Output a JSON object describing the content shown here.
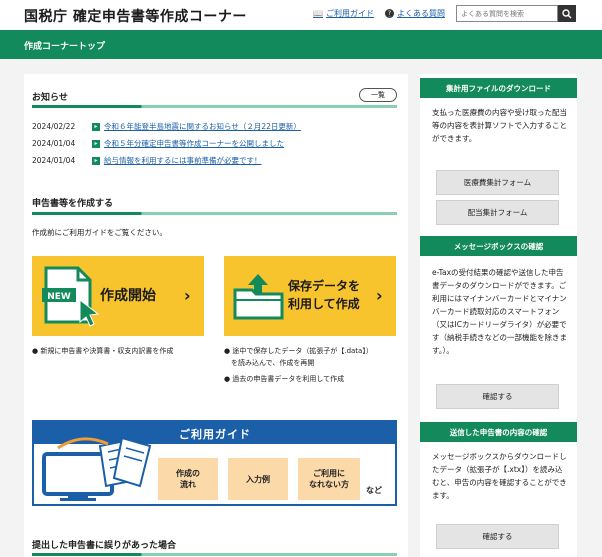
{
  "header": {
    "site_title": "国税庁 確定申告書等作成コーナー",
    "guide_link": "ご利用ガイド",
    "faq_link": "よくある質問",
    "search_placeholder": "よくある質問を検索"
  },
  "page_bar": {
    "title": "作成コーナートップ"
  },
  "news": {
    "title": "お知らせ",
    "list_button": "一覧",
    "items": [
      {
        "date": "2024/02/22",
        "text": "令和６年能登半島地震に関するお知らせ（２月22日更新）"
      },
      {
        "date": "2024/01/04",
        "text": "令和５年分確定申告書等作成コーナーを公開しました"
      },
      {
        "date": "2024/01/04",
        "text": "給与情報を利用するには事前準備が必要です！"
      }
    ]
  },
  "create": {
    "title": "申告書等を作成する",
    "note": "作成前にご利用ガイドをご覧ください。",
    "new_button": {
      "badge": "NEW",
      "label": "作成開始"
    },
    "saved_button": {
      "label_line1": "保存データを",
      "label_line2": "利用して作成"
    },
    "new_bullets": [
      "新規に申告書や決算書・収支内訳書を作成"
    ],
    "saved_bullets": [
      "途中で保存したデータ（拡張子が【.data】）",
      "を読み込んで、作成を再開",
      "過去の申告書データを利用して作成"
    ]
  },
  "guide_banner": {
    "title": "ご利用ガイド",
    "card1_line1": "作成の",
    "card1_line2": "流れ",
    "card2": "入力例",
    "card3_line1": "ご利用に",
    "card3_line2": "なれない方",
    "suffix": "など"
  },
  "submitted": {
    "title": "提出した申告書に誤りがあった場合"
  },
  "sidebar": {
    "download": {
      "title": "集計用ファイルのダウンロード",
      "text": "支払った医療費の内容や受け取った配当等の内容を表計算ソフトで入力することができます。",
      "btn1": "医療費集計フォーム",
      "btn2": "配当集計フォーム"
    },
    "messagebox": {
      "title": "メッセージボックスの確認",
      "text": "e-Taxの受付結果の確認や送信した申告書データのダウンロードができます。ご利用にはマイナンバーカードとマイナンバーカード読取対応のスマートフォン（又はICカードリーダライタ）が必要です（納税手続きなどの一部機能を除きます。）。",
      "btn": "確認する"
    },
    "sent": {
      "title": "送信した申告書の内容の確認",
      "text": "メッセージボックスからダウンロードしたデータ（拡張子が【.xtx】）を読み込むと、申告の内容を確認することができます。",
      "btn": "確認する"
    }
  },
  "colors": {
    "brand_green": "#138a5b",
    "accent_yellow": "#f7c42e",
    "link_blue": "#1a5fa8"
  }
}
